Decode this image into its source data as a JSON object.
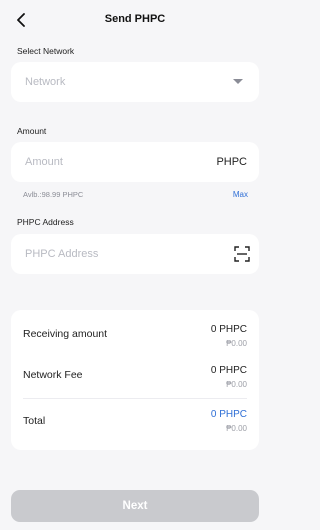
{
  "header": {
    "title": "Send PHPC"
  },
  "network": {
    "label": "Select Network",
    "placeholder": "Network"
  },
  "amount": {
    "label": "Amount",
    "placeholder": "Amount",
    "unit": "PHPC",
    "available": "Avlb.:98.99 PHPC",
    "max_label": "Max"
  },
  "address": {
    "label": "PHPC Address",
    "placeholder": "PHPC Address"
  },
  "summary": {
    "receiving": {
      "label": "Receiving amount",
      "amount": "0 PHPC",
      "fiat": "₱0.00"
    },
    "fee": {
      "label": "Network Fee",
      "amount": "0 PHPC",
      "fiat": "₱0.00"
    },
    "total": {
      "label": "Total",
      "amount": "0 PHPC",
      "fiat": "₱0.00"
    }
  },
  "next_label": "Next",
  "colors": {
    "accent": "#2f6fd6",
    "button_disabled": "#c9cace",
    "background": "#f6f6f8"
  },
  "icons": {
    "back": "chevron-left-icon",
    "dropdown": "caret-down-icon",
    "scan": "scan-icon"
  }
}
